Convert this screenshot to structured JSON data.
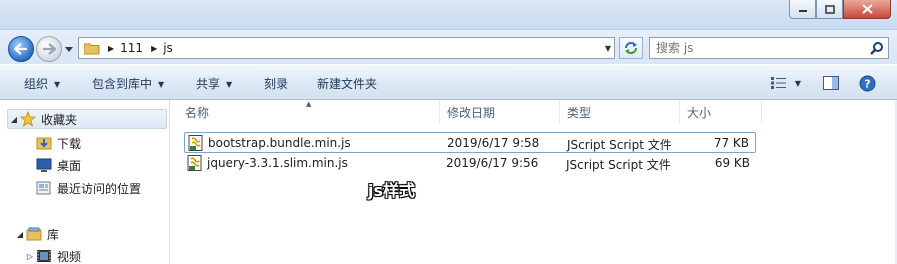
{
  "address": {
    "crumbs": [
      "111",
      "js"
    ]
  },
  "search": {
    "placeholder": "搜索 js"
  },
  "toolbar": {
    "organize": "组织",
    "include_in_library": "包含到库中",
    "share": "共享",
    "burn": "刻录",
    "new_folder": "新建文件夹"
  },
  "nav": {
    "favorites": "收藏夹",
    "downloads": "下载",
    "desktop": "桌面",
    "recent": "最近访问的位置",
    "libraries": "库",
    "videos": "视频"
  },
  "columns": {
    "name": "名称",
    "date": "修改日期",
    "type": "类型",
    "size": "大小"
  },
  "files": [
    {
      "name": "bootstrap.bundle.min.js",
      "date": "2019/6/17 9:58",
      "type": "JScript Script 文件",
      "size": "77 KB"
    },
    {
      "name": "jquery-3.3.1.slim.min.js",
      "date": "2019/6/17 9:56",
      "type": "JScript Script 文件",
      "size": "69 KB"
    }
  ],
  "caption": "js样式",
  "colors": {
    "accent": "#1e395b",
    "selection_border": "#7da2ce"
  }
}
